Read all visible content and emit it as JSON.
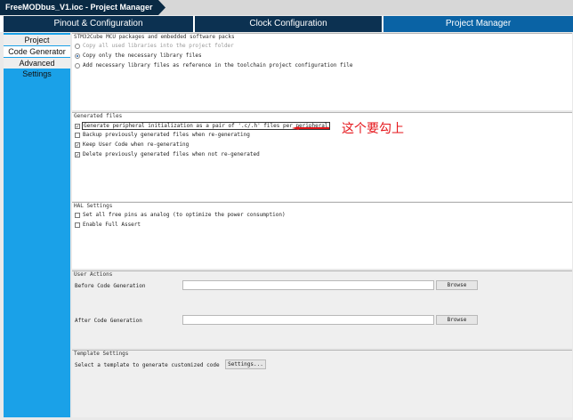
{
  "window": {
    "title": "FreeMODbus_V1.ioc - Project Manager"
  },
  "tabs": [
    {
      "label": "Pinout & Configuration"
    },
    {
      "label": "Clock Configuration"
    },
    {
      "label": "Project Manager"
    }
  ],
  "sidebar": {
    "items": [
      {
        "label": "Project"
      },
      {
        "label": "Code Generator"
      },
      {
        "label": "Advanced Settings"
      }
    ]
  },
  "packs": {
    "title": "STM32Cube MCU packages and embedded software packs",
    "options": [
      {
        "label": "Copy all used libraries into the project folder"
      },
      {
        "label": "Copy only the necessary library files"
      },
      {
        "label": "Add necessary library files as reference in the toolchain project configuration file"
      }
    ]
  },
  "generated_files": {
    "title": "Generated files",
    "options": [
      {
        "label": "Generate peripheral initialization as a pair of '.c/.h' files per peripheral"
      },
      {
        "label": "Backup previously generated files when re-generating"
      },
      {
        "label": "Keep User Code when re-generating"
      },
      {
        "label": "Delete previously generated files when not re-generated"
      }
    ]
  },
  "annotation": {
    "text": "这个要勾上",
    "color": "#e5161b"
  },
  "hal": {
    "title": "HAL Settings",
    "options": [
      {
        "label": "Set all free pins as analog (to optimize the power consumption)"
      },
      {
        "label": "Enable Full Assert"
      }
    ]
  },
  "user_actions": {
    "title": "User Actions",
    "before_label": "Before Code Generation",
    "before_value": "",
    "after_label": "After Code Generation",
    "after_value": "",
    "browse_label": "Browse"
  },
  "template": {
    "title": "Template Settings",
    "select_label": "Select a template to generate customized code",
    "settings_button": "Settings..."
  },
  "colors": {
    "accent": "#1aa1e8",
    "tab_active": "#0a63a5",
    "tab_inactive": "#0c3151",
    "title": "#0a2a44"
  }
}
